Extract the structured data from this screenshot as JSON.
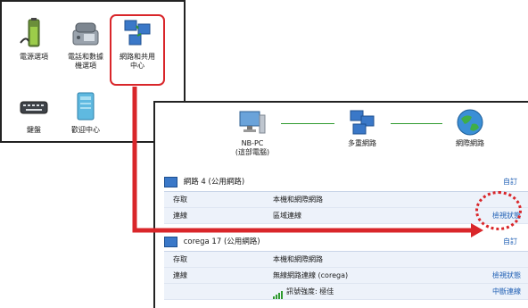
{
  "control_panel": {
    "items": [
      {
        "label": "電源選項",
        "icon": "battery-icon"
      },
      {
        "label": "電話和數據\n機選項",
        "icon": "phone-modem-icon"
      },
      {
        "label": "網路和共用\n中心",
        "icon": "network-sharing-icon"
      },
      {
        "label": "鍵盤",
        "icon": "keyboard-icon"
      },
      {
        "label": "歡迎中心",
        "icon": "welcome-center-icon"
      }
    ]
  },
  "network_map": {
    "computer": {
      "name": "NB-PC",
      "sub": "(這部電腦)"
    },
    "middle": {
      "name": "多重網路"
    },
    "internet": {
      "name": "網際網路"
    }
  },
  "networks": [
    {
      "title": "網路 4 (公用網路)",
      "customize": "自訂",
      "rows": [
        {
          "label": "存取",
          "value": "本機和網際網路",
          "action": ""
        },
        {
          "label": "連線",
          "value": "區域連線",
          "action": "檢視狀態"
        }
      ]
    },
    {
      "title": "corega 17 (公用網路)",
      "customize": "自訂",
      "rows": [
        {
          "label": "存取",
          "value": "本機和網際網路",
          "action": ""
        },
        {
          "label": "連線",
          "value": "無線網路連線 (corega)",
          "action": "檢視狀態"
        },
        {
          "label": "",
          "value": "訊號強度: 極佳",
          "action": "中斷連線"
        }
      ]
    }
  ],
  "colors": {
    "highlight": "#d9262a",
    "link": "#1f5fb4",
    "connector": "#2f9a2f"
  }
}
